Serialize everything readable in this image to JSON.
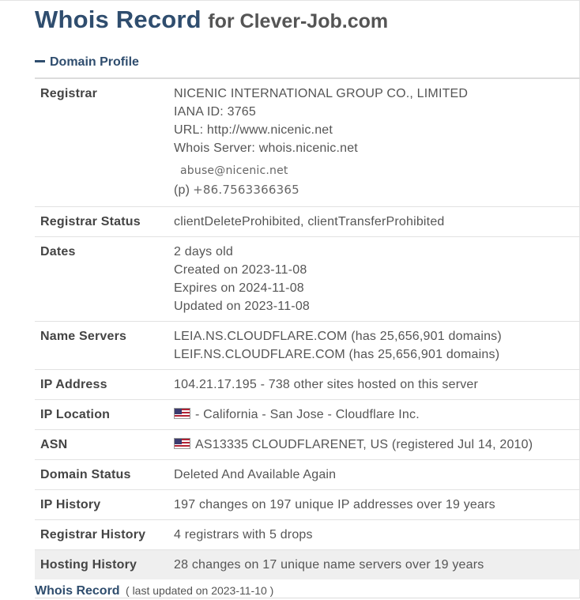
{
  "header": {
    "title": "Whois Record",
    "subtitle": "for Clever-Job.com"
  },
  "section": {
    "title": "Domain Profile",
    "toggle_icon": "minus-icon"
  },
  "profile": {
    "registrar": {
      "label": "Registrar",
      "name": "NICENIC INTERNATIONAL GROUP CO., LIMITED",
      "iana": "IANA ID: 3765",
      "url": "URL: http://www.nicenic.net",
      "whois_server": "Whois Server: whois.nicenic.net",
      "email": "abuse@nicenic.net",
      "phone_label": "(p)",
      "phone": "+86.7563366365"
    },
    "registrar_status": {
      "label": "Registrar Status",
      "value": "clientDeleteProhibited, clientTransferProhibited"
    },
    "dates": {
      "label": "Dates",
      "age": "2 days old",
      "created": "Created on 2023-11-08",
      "expires": "Expires on 2024-11-08",
      "updated": "Updated on 2023-11-08"
    },
    "name_servers": {
      "label": "Name Servers",
      "ns1": "LEIA.NS.CLOUDFLARE.COM (has 25,656,901 domains)",
      "ns2": "LEIF.NS.CLOUDFLARE.COM (has 25,656,901 domains)"
    },
    "ip_address": {
      "label": "IP Address",
      "value": "104.21.17.195 - 738 other sites hosted on this server"
    },
    "ip_location": {
      "label": "IP Location",
      "flag_icon": "us-flag-icon",
      "value": "- California - San Jose - Cloudflare Inc."
    },
    "asn": {
      "label": "ASN",
      "flag_icon": "us-flag-icon",
      "value": "AS13335 CLOUDFLARENET, US (registered Jul 14, 2010)"
    },
    "domain_status": {
      "label": "Domain Status",
      "value": "Deleted And Available Again"
    },
    "ip_history": {
      "label": "IP History",
      "value": "197 changes on 197 unique IP addresses over 19 years"
    },
    "registrar_history": {
      "label": "Registrar History",
      "value": "4 registrars with 5 drops"
    },
    "hosting_history": {
      "label": "Hosting History",
      "value": "28 changes on 17 unique name servers over 19 years"
    }
  },
  "footer": {
    "title": "Whois Record",
    "note": "( last updated on 2023-11-10 )"
  },
  "colors": {
    "heading_blue": "#2f4d6e",
    "text_gray": "#555555",
    "row_shade": "#efefef",
    "divider": "#e2e2e2"
  }
}
